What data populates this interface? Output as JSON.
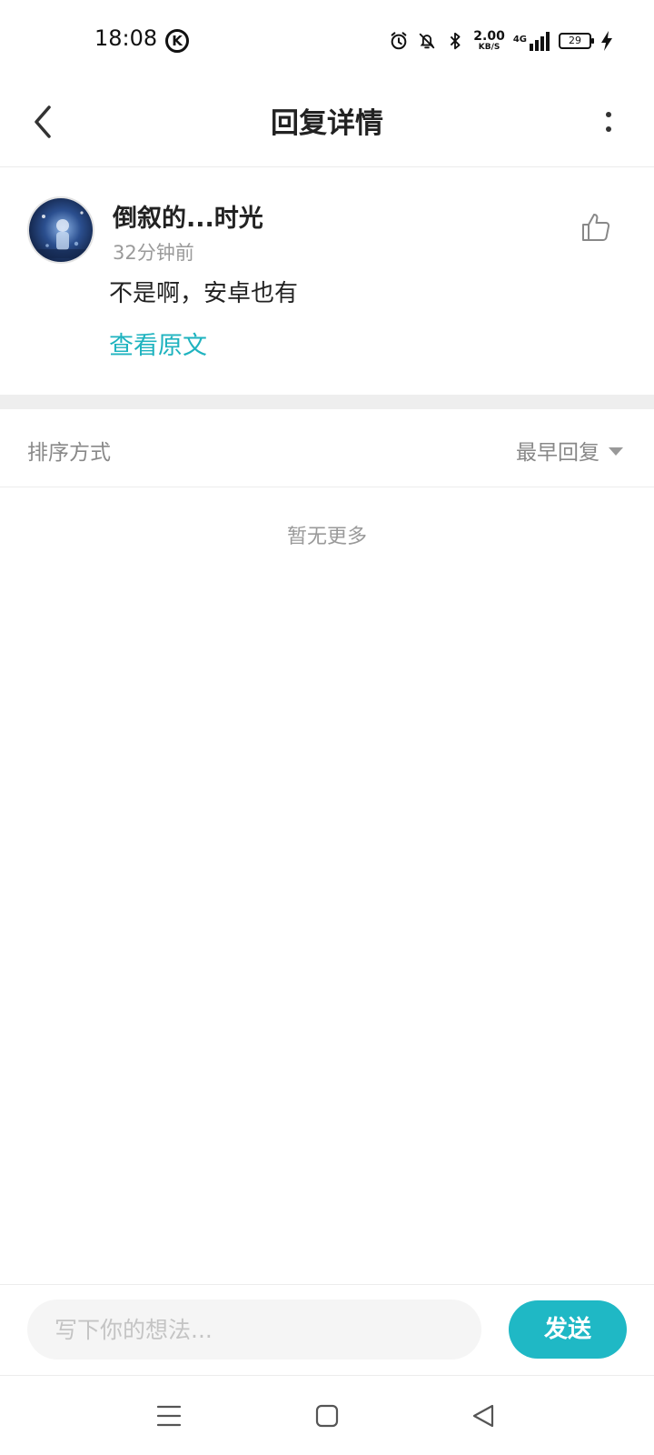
{
  "status_bar": {
    "time": "18:08",
    "k_badge": "K",
    "speed_value": "2.00",
    "speed_unit": "KB/S",
    "network": "4G",
    "battery": "29",
    "icons": [
      "alarm-icon",
      "bell-off-icon",
      "bluetooth-icon",
      "signal-icon",
      "battery-icon",
      "charging-icon"
    ]
  },
  "header": {
    "title": "回复详情",
    "icons": [
      "back-arrow-icon",
      "more-vertical-icon"
    ]
  },
  "comment": {
    "username": "倒叙的...时光",
    "time_ago": "32分钟前",
    "content": "不是啊，安卓也有",
    "view_original": "查看原文",
    "like_icon": "thumbs-up-icon"
  },
  "sort": {
    "label": "排序方式",
    "selected": "最早回复"
  },
  "empty_state": "暂无更多",
  "input_bar": {
    "placeholder": "写下你的想法...",
    "value": "",
    "send_label": "发送"
  },
  "system_nav": {
    "icons": [
      "menu-icon",
      "home-square-icon",
      "back-triangle-icon"
    ]
  },
  "colors": {
    "accent": "#1fb8c5",
    "link": "#1fb3bf",
    "muted_text": "#9a9a9a",
    "divider": "#eeeeee"
  }
}
